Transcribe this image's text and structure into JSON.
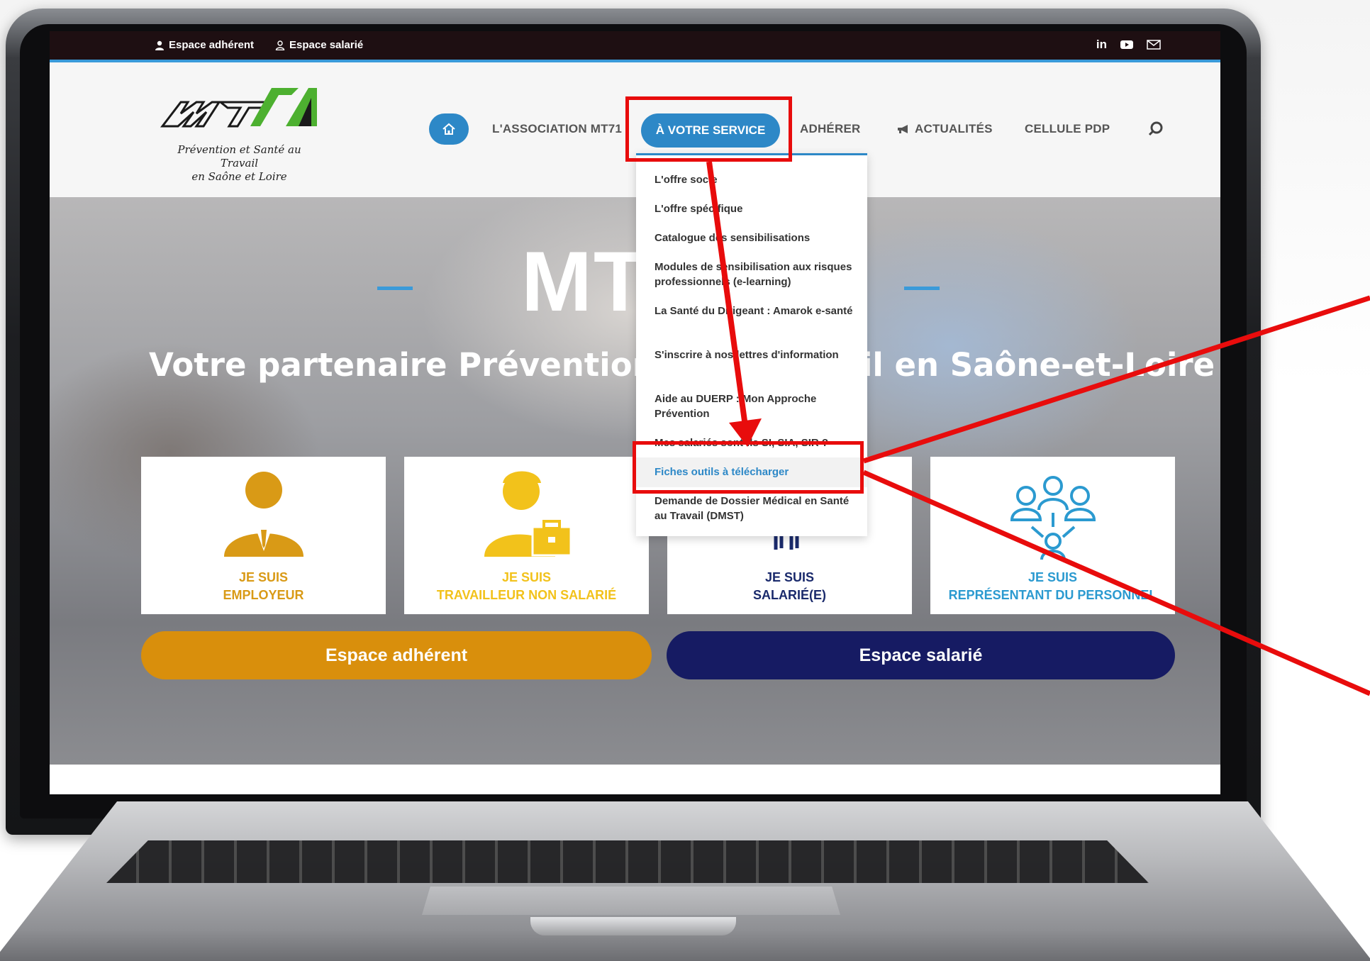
{
  "topbar": {
    "espace_adherent": "Espace adhérent",
    "espace_salarie": "Espace salarié",
    "linkedin_icon_text": "in",
    "colors": {
      "background": "#1e0f12",
      "accent_line": "#3a9ad9"
    }
  },
  "logo": {
    "mark": "MT71",
    "tagline_line1": "Prévention et Santé au Travail",
    "tagline_line2": "en Saône et Loire"
  },
  "nav": {
    "home_icon": "home-icon",
    "items": [
      {
        "label": "L'ASSOCIATION MT71"
      },
      {
        "label": "À VOTRE SERVICE",
        "active": true
      },
      {
        "label": "ADHÉRER"
      },
      {
        "label": "ACTUALITÉS",
        "icon": "megaphone-icon"
      },
      {
        "label": "CELLULE PDP"
      }
    ],
    "search_icon": "search-icon",
    "colors": {
      "active_bg": "#2d88c7",
      "text": "#555555"
    }
  },
  "dropdown": {
    "items": [
      {
        "label": "L'offre socle"
      },
      {
        "label": "L'offre spécifique"
      },
      {
        "label": "Catalogue des sensibilisations"
      },
      {
        "label": "Modules de sensibilisation aux risques professionnels (e-learning)"
      },
      {
        "label": "La Santé du Dirigeant : Amarok e-santé"
      },
      {
        "label": "S'inscrire à nos lettres d'information"
      },
      {
        "label": "Aide au DUERP : Mon Approche Prévention"
      },
      {
        "label": "Mes salariés sont-ils SI, SIA, SIR ?"
      },
      {
        "label": "Fiches outils à télécharger",
        "highlighted": true
      },
      {
        "label": "Demande de Dossier Médical en Santé au Travail (DMST)"
      }
    ]
  },
  "hero": {
    "title": "MT71",
    "title_visible": "MT",
    "subtitle_left": "Votre partenaire Prévention & S",
    "subtitle_right": "il en Saône-et-Loire",
    "cards": [
      {
        "line1": "JE SUIS",
        "line2": "EMPLOYEUR",
        "color": "#d99a16",
        "icon": "employer-icon"
      },
      {
        "line1": "JE SUIS",
        "line2": "TRAVAILLEUR NON SALARIÉ",
        "color": "#f2c21b",
        "icon": "self-employed-icon"
      },
      {
        "line1": "JE SUIS",
        "line2": "SALARIÉ(E)",
        "color": "#1a2a6c",
        "icon": "employee-icon"
      },
      {
        "line1": "JE SUIS",
        "line2": "REPRÉSENTANT DU PERSONNEL",
        "color": "#2b9ad0",
        "icon": "representative-icon"
      }
    ],
    "cta_adherent": {
      "label": "Espace adhérent",
      "color": "#d98f0c"
    },
    "cta_salarie": {
      "label": "Espace salarié",
      "color": "#161b63"
    }
  },
  "annotation": {
    "color": "#e80c0c"
  }
}
